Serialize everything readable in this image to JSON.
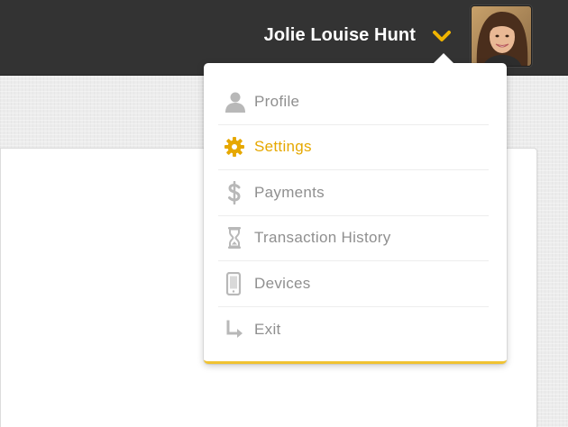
{
  "header": {
    "user_name": "Jolie Louise Hunt",
    "toggle_icon": "chevron-down-icon",
    "avatar_icon": "user-avatar"
  },
  "menu": {
    "items": [
      {
        "label": "Profile",
        "icon": "person-icon",
        "active": false
      },
      {
        "label": "Settings",
        "icon": "gear-icon",
        "active": true
      },
      {
        "label": "Payments",
        "icon": "dollar-icon",
        "active": false
      },
      {
        "label": "Transaction History",
        "icon": "hourglass-icon",
        "active": false
      },
      {
        "label": "Devices",
        "icon": "phone-icon",
        "active": false
      },
      {
        "label": "Exit",
        "icon": "exit-arrow-icon",
        "active": false
      }
    ]
  },
  "colors": {
    "topbar": "#333333",
    "accent": "#e6a800",
    "menu_text": "#8f8f8f",
    "icon_gray": "#b8b8b8"
  }
}
